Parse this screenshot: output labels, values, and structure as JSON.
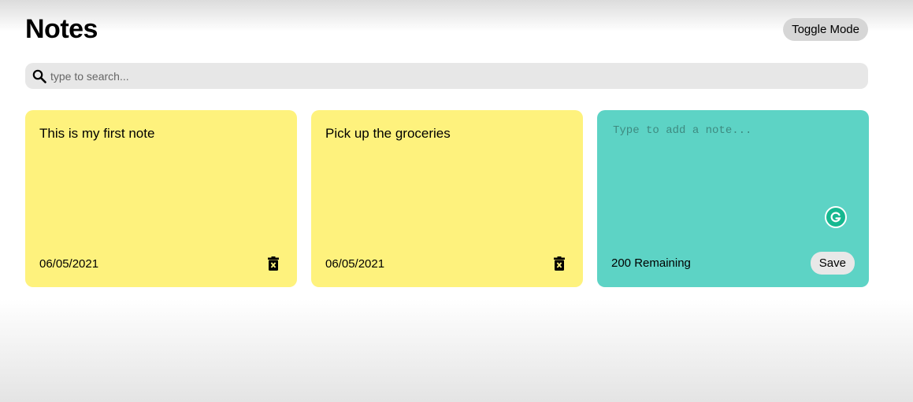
{
  "header": {
    "title": "Notes",
    "toggle_label": "Toggle Mode"
  },
  "search": {
    "placeholder": "type to search...",
    "value": "",
    "icon": "search-icon"
  },
  "notes": [
    {
      "text": "This is my first note",
      "date": "06/05/2021",
      "color": "#fef27d",
      "icon": "trash-icon"
    },
    {
      "text": "Pick up the groceries",
      "date": "06/05/2021",
      "color": "#fef27d",
      "icon": "trash-icon"
    }
  ],
  "new_note": {
    "placeholder": "Type to add a note...",
    "value": "",
    "remaining": "200 Remaining",
    "save_label": "Save",
    "color": "#5dd3c5",
    "extension_icon": "grammarly-icon"
  }
}
